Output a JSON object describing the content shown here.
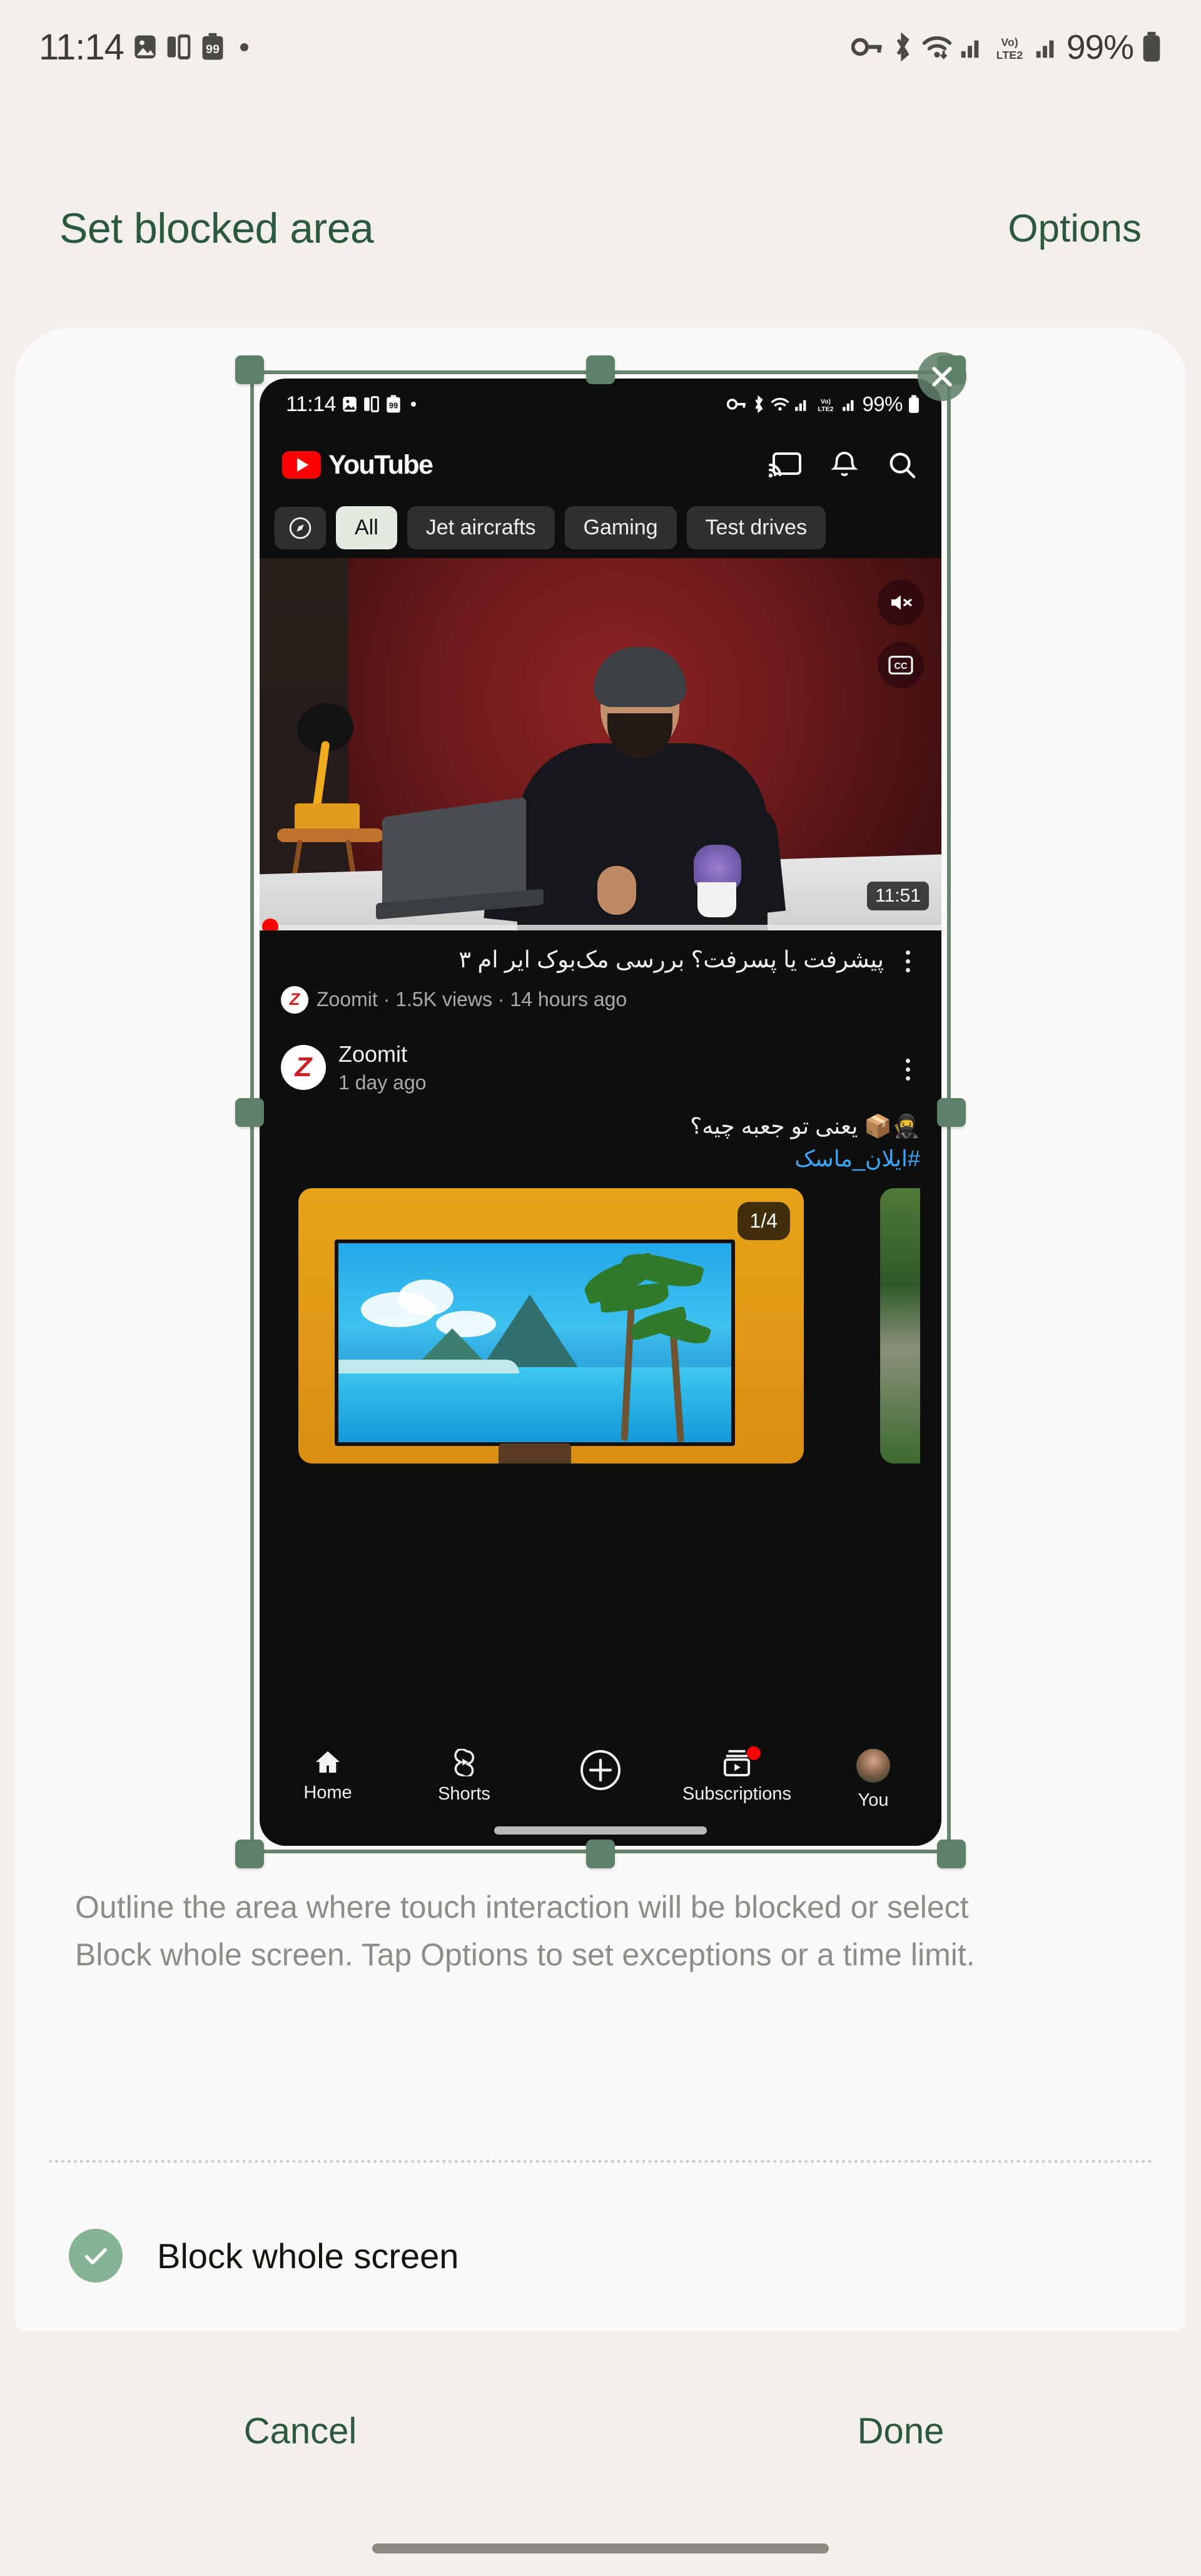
{
  "status_bar": {
    "time": "11:14",
    "battery_percent": "99%",
    "notification_badge": "99",
    "left_icons": [
      "image-icon",
      "multi-window-icon",
      "battery-badge-99-icon",
      "dot-indicator"
    ],
    "right_icons": [
      "key-icon",
      "bluetooth-icon",
      "wifi-icon",
      "signal-icon",
      "volte2-icon",
      "signal2-icon",
      "battery-icon"
    ]
  },
  "header": {
    "title": "Set blocked area",
    "options_label": "Options"
  },
  "preview": {
    "close_label": "Close",
    "phone_status": {
      "time": "11:14",
      "battery_percent": "99%",
      "network_label": "LTE2",
      "volte_label": "Vo)"
    },
    "youtube": {
      "brand": "YouTube",
      "actions": [
        "cast-icon",
        "notifications-bell-icon",
        "search-icon"
      ],
      "chips": [
        {
          "label": "",
          "icon": "explore-compass-icon",
          "active": false
        },
        {
          "label": "All",
          "active": true
        },
        {
          "label": "Jet aircrafts",
          "active": false
        },
        {
          "label": "Gaming",
          "active": false
        },
        {
          "label": "Test drives",
          "active": false
        }
      ],
      "video": {
        "duration": "11:51",
        "title": "پیشرفت یا پسرفت؟ بررسی مک‌بوک ایر ام ۳",
        "meta": "Zoomit · 1.5K views · 14 hours ago",
        "channel_initial": "Z",
        "mute_icon": "volume-muted-icon",
        "cc_icon": "closed-captions-icon"
      },
      "post": {
        "channel": "Zoomit",
        "time": "1 day ago",
        "channel_initial": "Z",
        "text": "🥷📦 یعنی تو جعبه چیه؟",
        "hashtag": "#ایلان_ماسک",
        "carousel_counter": "1/4"
      },
      "bottom_nav": [
        {
          "label": "Home",
          "icon": "home-icon",
          "badge": false
        },
        {
          "label": "Shorts",
          "icon": "shorts-icon",
          "badge": false
        },
        {
          "label": "",
          "icon": "create-plus-icon",
          "badge": false
        },
        {
          "label": "Subscriptions",
          "icon": "subscriptions-icon",
          "badge": true
        },
        {
          "label": "You",
          "icon": "account-avatar-icon",
          "badge": false
        }
      ]
    }
  },
  "description": "Outline the area where touch interaction will be blocked or select Block whole screen. Tap Options to set exceptions or a time limit.",
  "block_whole_screen": {
    "label": "Block whole screen",
    "checked": true
  },
  "footer": {
    "cancel_label": "Cancel",
    "done_label": "Done"
  },
  "colors": {
    "page_background": "#F3F0EB",
    "sheet_background": "#FBFAF9",
    "accent_green": "#2D5840",
    "handle_green": "#5D8068",
    "check_green": "#85B394",
    "youtube_red": "#FF0000",
    "link_blue": "#3EA6FF",
    "muted_text": "#8E8C88"
  }
}
